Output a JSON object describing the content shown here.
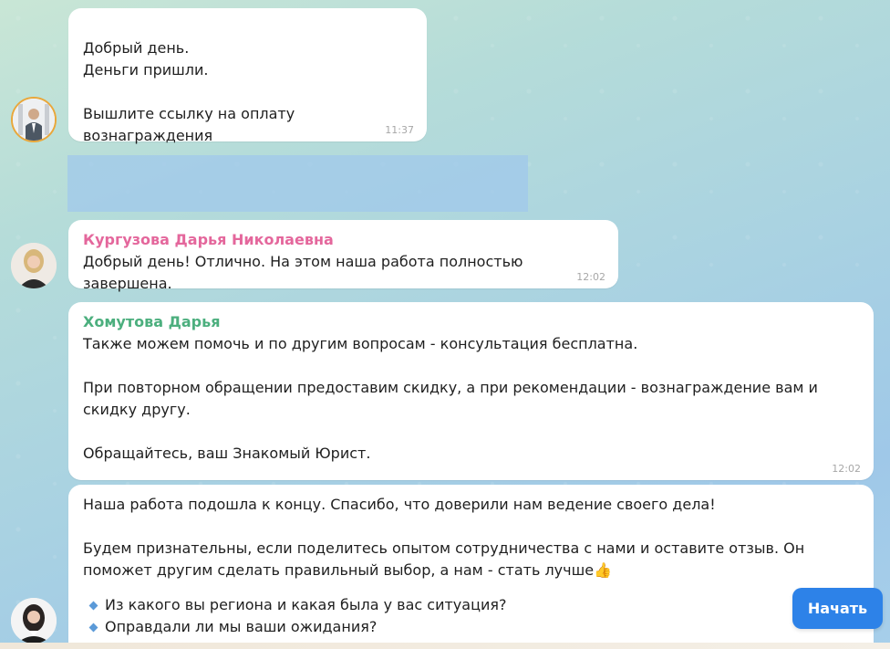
{
  "colors": {
    "sender_1": "#e4679c",
    "sender_2": "#4caf7e",
    "button": "#2d82e8",
    "bullet": "#5b9ad8"
  },
  "messages": [
    {
      "text": "Добрый день.\nДеньги пришли.\n\nВышлите ссылку на оплату вознаграждения",
      "time": "11:37"
    },
    {
      "sender": "Кургузова Дарья Николаевна",
      "text": "Добрый день! Отлично. На этом наша работа полностью завершена.",
      "time": "12:02"
    },
    {
      "sender": "Хомутова Дарья",
      "text": "Также можем помочь и по другим вопросам - консультация бесплатна.\n\nПри повторном обращении предоставим скидку, а при рекомендации - вознаграждение вам и скидку другу.\n\nОбращайтесь, ваш Знакомый Юрист.",
      "time": "12:02"
    },
    {
      "text_1": "Наша работа подошла к концу. Спасибо, что доверили нам ведение своего дела!",
      "text_2": "Будем признательны, если поделитесь опытом сотрудничества с нами и оставите отзыв. Он поможет другим сделать правильный выбор, а нам - стать лучше",
      "emoji": "👍",
      "bullets": [
        "Из какого вы региона и какая была у вас ситуация?",
        "Оправдали ли мы ваши ожидания?"
      ]
    }
  ],
  "start_button": {
    "label": "Начать"
  },
  "icons": {
    "avatar_1": "user-avatar-man-photo",
    "avatar_2": "user-avatar-woman-photo",
    "avatar_3": "bot-avatar-woman-photo",
    "bullet": "blue-diamond-icon"
  }
}
